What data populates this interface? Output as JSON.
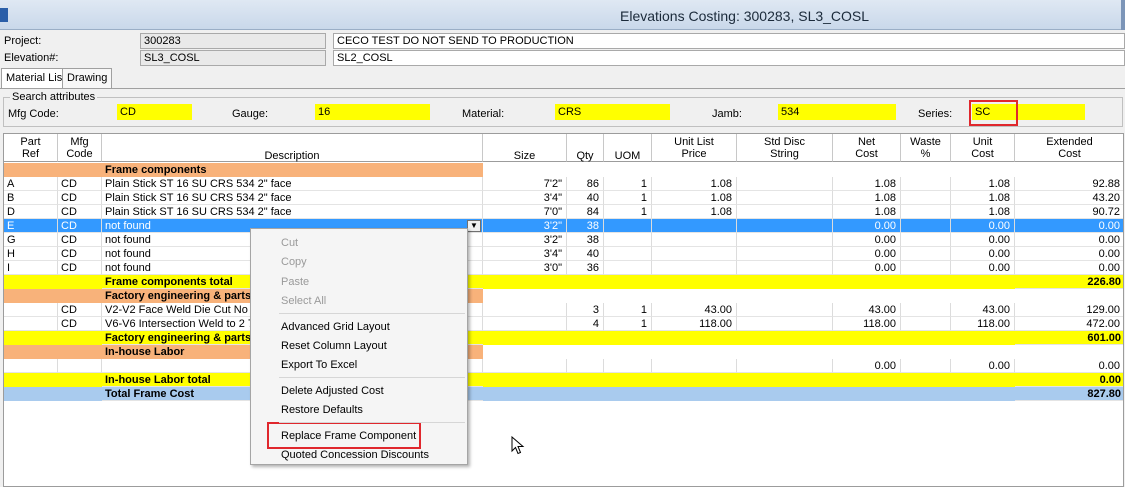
{
  "window": {
    "title": "Elevations Costing: 300283, SL3_COSL"
  },
  "header": {
    "project_label": "Project:",
    "project_id": "300283",
    "project_name": "CECO TEST DO NOT SEND TO PRODUCTION",
    "elevation_label": "Elevation#:",
    "elevation_id": "SL3_COSL",
    "elevation_name": "SL2_COSL"
  },
  "tabs": [
    "Material List",
    "Drawing"
  ],
  "search": {
    "legend": "Search attributes",
    "mfg_code_label": "Mfg Code:",
    "mfg_code": "CD",
    "gauge_label": "Gauge:",
    "gauge": "16",
    "material_label": "Material:",
    "material": "CRS",
    "jamb_label": "Jamb:",
    "jamb": "534",
    "series_label": "Series:",
    "series": "SC"
  },
  "columns": {
    "part_ref": [
      "Part",
      "Ref"
    ],
    "mfg_code": [
      "Mfg",
      "Code"
    ],
    "description": "Description",
    "size": "Size",
    "qty": "Qty",
    "uom": "UOM",
    "unit_list_price": [
      "Unit List",
      "Price"
    ],
    "std_disc_string": [
      "Std Disc",
      "String"
    ],
    "net_cost": [
      "Net",
      "Cost"
    ],
    "waste_pct": [
      "Waste",
      "%"
    ],
    "unit_cost": [
      "Unit",
      "Cost"
    ],
    "extended_cost": [
      "Extended",
      "Cost"
    ]
  },
  "rows": [
    {
      "type": "section",
      "description": "Frame components"
    },
    {
      "ref": "A",
      "mfg": "CD",
      "description": "Plain Stick ST 16 SU CRS   534 2\"  face",
      "size": "7'2\"",
      "qty": "86",
      "uom": "1",
      "unit_list": "1.08",
      "net": "1.08",
      "unit": "1.08",
      "ext": "92.88"
    },
    {
      "ref": "B",
      "mfg": "CD",
      "description": "Plain Stick ST 16 SU CRS   534 2\"  face",
      "size": "3'4\"",
      "qty": "40",
      "uom": "1",
      "unit_list": "1.08",
      "net": "1.08",
      "unit": "1.08",
      "ext": "43.20"
    },
    {
      "ref": "D",
      "mfg": "CD",
      "description": "Plain Stick ST 16 SU CRS   534 2\"  face",
      "size": "7'0\"",
      "qty": "84",
      "uom": "1",
      "unit_list": "1.08",
      "net": "1.08",
      "unit": "1.08",
      "ext": "90.72"
    },
    {
      "ref": "E",
      "mfg": "CD",
      "description": "not found",
      "size": "3'2\"",
      "qty": "38",
      "uom": "",
      "unit_list": "",
      "net": "0.00",
      "unit": "0.00",
      "ext": "0.00",
      "selected": true
    },
    {
      "ref": "G",
      "mfg": "CD",
      "description": "not found",
      "size": "3'2\"",
      "qty": "38",
      "uom": "",
      "unit_list": "",
      "net": "0.00",
      "unit": "0.00",
      "ext": "0.00"
    },
    {
      "ref": "H",
      "mfg": "CD",
      "description": "not found",
      "size": "3'4\"",
      "qty": "40",
      "uom": "",
      "unit_list": "",
      "net": "0.00",
      "unit": "0.00",
      "ext": "0.00"
    },
    {
      "ref": "I",
      "mfg": "CD",
      "description": "not found",
      "size": "3'0\"",
      "qty": "36",
      "uom": "",
      "unit_list": "",
      "net": "0.00",
      "unit": "0.00",
      "ext": "0.00"
    },
    {
      "type": "total",
      "description": "Frame components total",
      "ext": "226.80"
    },
    {
      "type": "section",
      "description": "Factory engineering & parts"
    },
    {
      "ref": "",
      "mfg": "CD",
      "description": "V2-V2 Face Weld Die Cut No Tabs",
      "size": "",
      "qty": "3",
      "uom": "1",
      "unit_list": "43.00",
      "net": "43.00",
      "unit": "43.00",
      "ext": "129.00"
    },
    {
      "ref": "",
      "mfg": "CD",
      "description": "V6-V6 Intersection Weld to 2 7/8\"",
      "size": "",
      "qty": "4",
      "uom": "1",
      "unit_list": "118.00",
      "net": "118.00",
      "unit": "118.00",
      "ext": "472.00"
    },
    {
      "type": "total",
      "description": "Factory engineering & parts to",
      "ext": "601.00"
    },
    {
      "type": "section",
      "description": "In-house Labor"
    },
    {
      "ref": "",
      "mfg": "",
      "description": "",
      "size": "",
      "qty": "",
      "uom": "",
      "unit_list": "",
      "net": "0.00",
      "unit": "0.00",
      "ext": "0.00"
    },
    {
      "type": "total",
      "description": "In-house Labor total",
      "ext": "0.00"
    },
    {
      "type": "grand",
      "description": "Total Frame Cost",
      "ext": "827.80"
    }
  ],
  "context_menu": {
    "items": [
      {
        "label": "Cut",
        "disabled": true
      },
      {
        "label": "Copy",
        "disabled": true
      },
      {
        "label": "Paste",
        "disabled": true
      },
      {
        "label": "Select All",
        "disabled": true
      },
      {
        "label": "Advanced Grid Layout",
        "disabled": false
      },
      {
        "label": "Reset Column Layout",
        "disabled": false
      },
      {
        "label": "Export To Excel",
        "disabled": false
      },
      {
        "label": "Delete Adjusted Cost",
        "disabled": false
      },
      {
        "label": "Restore Defaults",
        "disabled": false
      },
      {
        "label": "Replace Frame Component",
        "disabled": false,
        "highlighted": true
      },
      {
        "label": "Quoted Concession Discounts",
        "disabled": false
      }
    ]
  },
  "colors": {
    "section_band": "#f8b27a",
    "total_band": "#ffff00",
    "grand_total_band": "#a9cbee",
    "selection": "#3399ff",
    "annotation_box": "#e0272d"
  }
}
